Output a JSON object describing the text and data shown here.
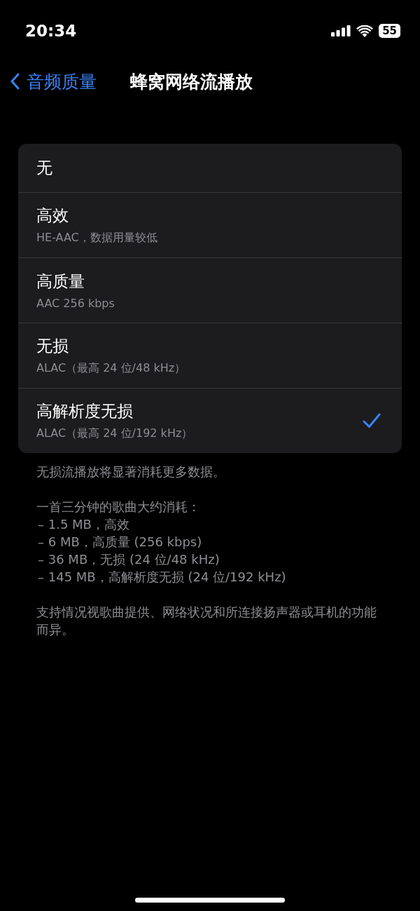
{
  "status_bar": {
    "time": "20:34",
    "battery": "55"
  },
  "nav": {
    "back": "音频质量",
    "title": "蜂窝网络流播放"
  },
  "options": [
    {
      "title": "无",
      "selected": false
    },
    {
      "title": "高效",
      "subtitle": "HE-AAC，数据用量较低",
      "selected": false
    },
    {
      "title": "高质量",
      "subtitle": "AAC 256 kbps",
      "selected": false
    },
    {
      "title": "无损",
      "subtitle": "ALAC（最高 24 位/48 kHz）",
      "selected": false
    },
    {
      "title": "高解析度无损",
      "subtitle": "ALAC（最高 24 位/192 kHz）",
      "selected": true
    }
  ],
  "footer": {
    "note": "无损流播放将显著消耗更多数据。",
    "usage_heading": "一首三分钟的歌曲大约消耗：",
    "usage_lines": [
      "– 1.5 MB，高效",
      "– 6 MB，高质量 (256 kbps)",
      "– 36 MB，无损 (24 位/48 kHz)",
      "– 145 MB，高解析度无损 (24 位/192 kHz)"
    ],
    "support": "支持情况视歌曲提供、网络状况和所连接扬声器或耳机的功能而异。"
  }
}
